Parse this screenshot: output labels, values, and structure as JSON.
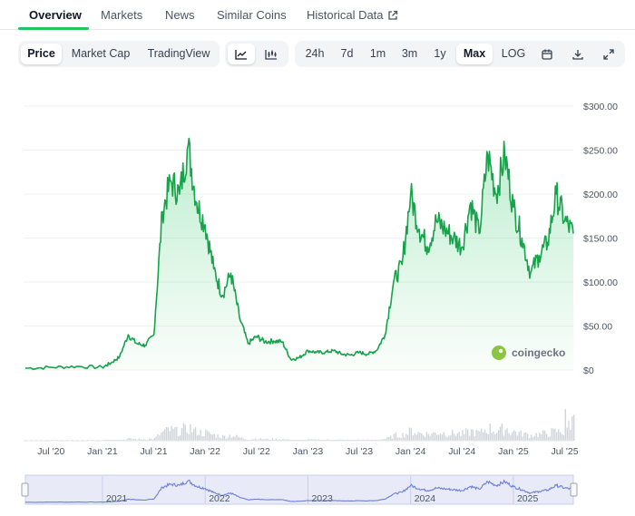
{
  "tabs": {
    "overview": "Overview",
    "markets": "Markets",
    "news": "News",
    "similar": "Similar Coins",
    "historical": "Historical Data"
  },
  "toolbar": {
    "price": "Price",
    "market_cap": "Market Cap",
    "trading_view": "TradingView",
    "range_24h": "24h",
    "range_7d": "7d",
    "range_1m": "1m",
    "range_3m": "3m",
    "range_1y": "1y",
    "range_max": "Max",
    "log": "LOG"
  },
  "colors": {
    "line": "#16a34a",
    "accent": "#22c55e",
    "navigator": "#6b7fd7"
  },
  "icons": [
    "line-chart-icon",
    "candlestick-icon",
    "calendar-icon",
    "download-icon",
    "expand-icon",
    "external-link-icon",
    "coingecko-logo-icon"
  ],
  "chart_data": {
    "type": "area",
    "watermark": "coingecko",
    "y_ticks": [
      "$300.00",
      "$250.00",
      "$200.00",
      "$150.00",
      "$100.00",
      "$50.00",
      "$0"
    ],
    "x_ticks": [
      "Jul '20",
      "Jan '21",
      "Jul '21",
      "Jan '22",
      "Jul '22",
      "Jan '23",
      "Jul '23",
      "Jan '24",
      "Jul '24",
      "Jan '25",
      "Jul '25"
    ],
    "navigator_labels": [
      "2021",
      "2022",
      "2023",
      "2024",
      "2025"
    ],
    "ylim": [
      0,
      300
    ],
    "xlim": [
      "2020-04",
      "2025-08"
    ],
    "grid": true,
    "series": [
      {
        "x": [
          "2020-04",
          "2020-07",
          "2020-10",
          "2021-01",
          "2021-02",
          "2021-03",
          "2021-04",
          "2021-05",
          "2021-06",
          "2021-07",
          "2021-08",
          "2021-09",
          "2021-10",
          "2021-11",
          "2021-12",
          "2022-01",
          "2022-02",
          "2022-03",
          "2022-04",
          "2022-05",
          "2022-06",
          "2022-07",
          "2022-08",
          "2022-09",
          "2022-10",
          "2022-11",
          "2022-12",
          "2023-01",
          "2023-02",
          "2023-03",
          "2023-04",
          "2023-05",
          "2023-06",
          "2023-07",
          "2023-08",
          "2023-09",
          "2023-10",
          "2023-11",
          "2023-12",
          "2024-01",
          "2024-02",
          "2024-03",
          "2024-04",
          "2024-05",
          "2024-06",
          "2024-07",
          "2024-08",
          "2024-09",
          "2024-10",
          "2024-11",
          "2024-12",
          "2025-01",
          "2025-02",
          "2025-03",
          "2025-04",
          "2025-05",
          "2025-06",
          "2025-07",
          "2025-08"
        ],
        "values": [
          2,
          3,
          4,
          3,
          8,
          15,
          40,
          30,
          28,
          40,
          180,
          215,
          200,
          255,
          190,
          165,
          115,
          85,
          110,
          60,
          30,
          38,
          32,
          33,
          32,
          12,
          14,
          22,
          20,
          20,
          22,
          18,
          17,
          20,
          18,
          22,
          40,
          100,
          120,
          200,
          160,
          140,
          170,
          160,
          150,
          140,
          190,
          155,
          245,
          200,
          245,
          185,
          150,
          110,
          130,
          145,
          200,
          170,
          155
        ]
      }
    ]
  }
}
